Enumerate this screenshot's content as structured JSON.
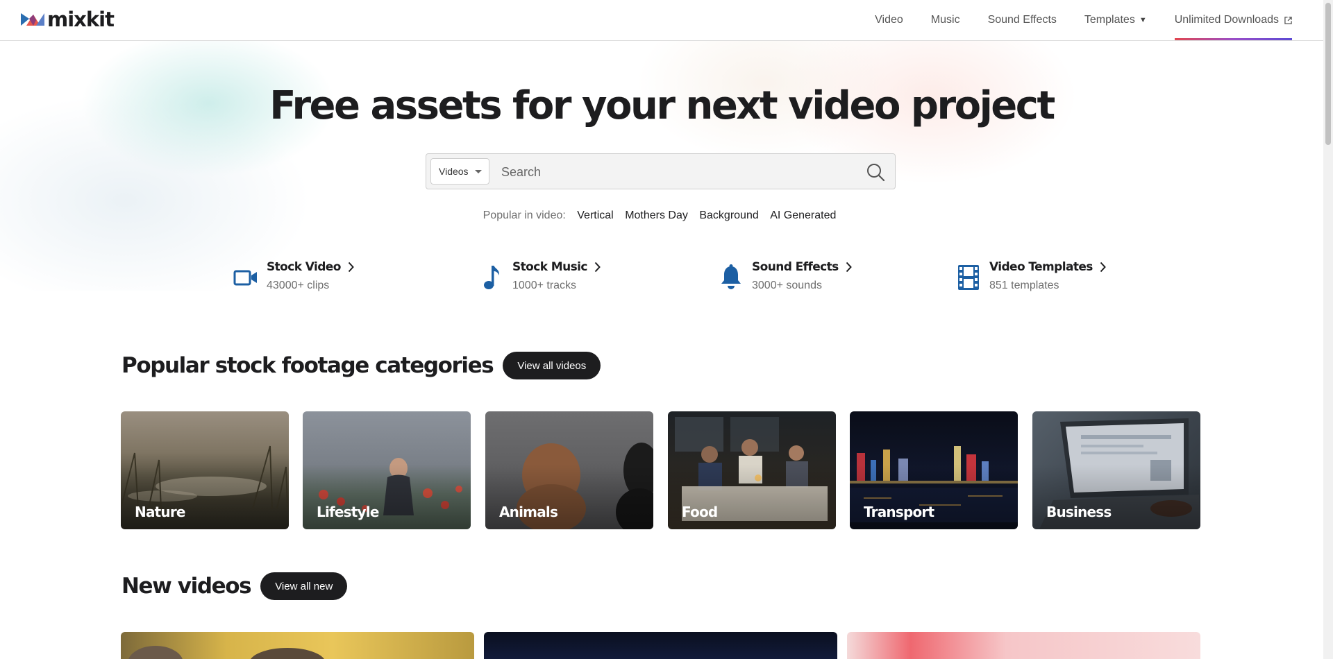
{
  "logo": {
    "text": "mixkit"
  },
  "nav": {
    "items": [
      {
        "label": "Video"
      },
      {
        "label": "Music"
      },
      {
        "label": "Sound Effects"
      },
      {
        "label": "Templates"
      },
      {
        "label": "Unlimited Downloads"
      }
    ]
  },
  "hero": {
    "title": "Free assets for your next video project",
    "search": {
      "category": "Videos",
      "placeholder": "Search"
    },
    "popular_label": "Popular in video:",
    "popular_tags": [
      "Vertical",
      "Mothers Day",
      "Background",
      "AI Generated"
    ]
  },
  "categories": [
    {
      "title": "Stock Video",
      "count": "43000+ clips",
      "icon": "video-camera-icon"
    },
    {
      "title": "Stock Music",
      "count": "1000+ tracks",
      "icon": "music-note-icon"
    },
    {
      "title": "Sound Effects",
      "count": "3000+ sounds",
      "icon": "bell-icon"
    },
    {
      "title": "Video Templates",
      "count": "851 templates",
      "icon": "film-strip-icon"
    }
  ],
  "popular_section": {
    "title": "Popular stock footage categories",
    "button": "View all videos",
    "tiles": [
      {
        "label": "Nature"
      },
      {
        "label": "Lifestyle"
      },
      {
        "label": "Animals"
      },
      {
        "label": "Food"
      },
      {
        "label": "Transport"
      },
      {
        "label": "Business"
      }
    ]
  },
  "new_section": {
    "title": "New videos",
    "button": "View all new"
  },
  "colors": {
    "brand_blue": "#1c5fa3",
    "dark": "#1d1d1f",
    "accent_gradient": [
      "#e2464f",
      "#9a4dc8",
      "#5c4ad4"
    ]
  }
}
